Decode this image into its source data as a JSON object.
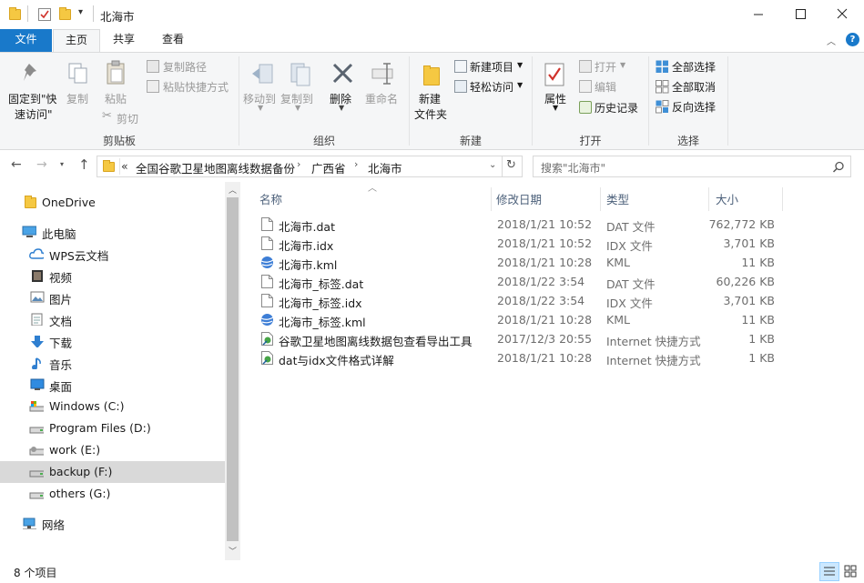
{
  "window": {
    "title": "北海市",
    "minimize_icon": "minimize-icon",
    "maximize_icon": "maximize-icon",
    "close_icon": "close-icon"
  },
  "tabs": {
    "file": "文件",
    "home": "主页",
    "share": "共享",
    "view": "查看"
  },
  "ribbon": {
    "clipboard": {
      "label": "剪贴板",
      "pin_line1": "固定到\"快",
      "pin_line2": "速访问\"",
      "copy": "复制",
      "paste": "粘贴",
      "copy_path": "复制路径",
      "paste_shortcut": "粘贴快捷方式",
      "cut": "剪切"
    },
    "organize": {
      "label": "组织",
      "move_to": "移动到",
      "copy_to": "复制到",
      "delete": "删除",
      "rename": "重命名"
    },
    "new": {
      "label": "新建",
      "new_folder_line1": "新建",
      "new_folder_line2": "文件夹",
      "new_item": "新建项目",
      "easy_access": "轻松访问"
    },
    "open": {
      "label": "打开",
      "properties": "属性",
      "open": "打开",
      "edit": "编辑",
      "history": "历史记录"
    },
    "select": {
      "label": "选择",
      "select_all": "全部选择",
      "select_none": "全部取消",
      "invert": "反向选择"
    }
  },
  "address": {
    "overflow": "«",
    "crumbs": [
      "全国谷歌卫星地图离线数据备份",
      "广西省",
      "北海市"
    ],
    "search_placeholder": "搜索\"北海市\""
  },
  "nav": {
    "items": [
      {
        "label": "OneDrive",
        "icon": "folder-icon"
      },
      {
        "label": "此电脑",
        "icon": "computer-icon"
      },
      {
        "label": "WPS云文档",
        "icon": "cloud-icon"
      },
      {
        "label": "视频",
        "icon": "video-icon"
      },
      {
        "label": "图片",
        "icon": "picture-icon"
      },
      {
        "label": "文档",
        "icon": "document-icon"
      },
      {
        "label": "下载",
        "icon": "download-icon"
      },
      {
        "label": "音乐",
        "icon": "music-icon"
      },
      {
        "label": "桌面",
        "icon": "desktop-icon"
      },
      {
        "label": "Windows (C:)",
        "icon": "drive-icon"
      },
      {
        "label": "Program Files (D:)",
        "icon": "drive-icon"
      },
      {
        "label": "work (E:)",
        "icon": "drive-icon"
      },
      {
        "label": "backup (F:)",
        "icon": "drive-icon"
      },
      {
        "label": "others (G:)",
        "icon": "drive-icon"
      },
      {
        "label": "网络",
        "icon": "network-icon"
      }
    ]
  },
  "columns": {
    "name": "名称",
    "date": "修改日期",
    "type": "类型",
    "size": "大小"
  },
  "files": [
    {
      "name": "北海市.dat",
      "date": "2018/1/21 10:52",
      "type": "DAT 文件",
      "size": "762,772 KB",
      "icon": "file-icon"
    },
    {
      "name": "北海市.idx",
      "date": "2018/1/21 10:52",
      "type": "IDX 文件",
      "size": "3,701 KB",
      "icon": "file-icon"
    },
    {
      "name": "北海市.kml",
      "date": "2018/1/21 10:28",
      "type": "KML",
      "size": "11 KB",
      "icon": "globe-icon"
    },
    {
      "name": "北海市_标签.dat",
      "date": "2018/1/22 3:54",
      "type": "DAT 文件",
      "size": "60,226 KB",
      "icon": "file-icon"
    },
    {
      "name": "北海市_标签.idx",
      "date": "2018/1/22 3:54",
      "type": "IDX 文件",
      "size": "3,701 KB",
      "icon": "file-icon"
    },
    {
      "name": "北海市_标签.kml",
      "date": "2018/1/21 10:28",
      "type": "KML",
      "size": "11 KB",
      "icon": "globe-icon"
    },
    {
      "name": "谷歌卫星地图离线数据包查看导出工具",
      "date": "2017/12/3 20:55",
      "type": "Internet 快捷方式",
      "size": "1 KB",
      "icon": "shortcut-icon"
    },
    {
      "name": "dat与idx文件格式详解",
      "date": "2018/1/21 10:28",
      "type": "Internet 快捷方式",
      "size": "1 KB",
      "icon": "shortcut-icon"
    }
  ],
  "status": {
    "count": "8 个项目"
  },
  "colors": {
    "accent": "#1979ca",
    "folder": "#f5c842",
    "selected": "#d9d9d9"
  }
}
